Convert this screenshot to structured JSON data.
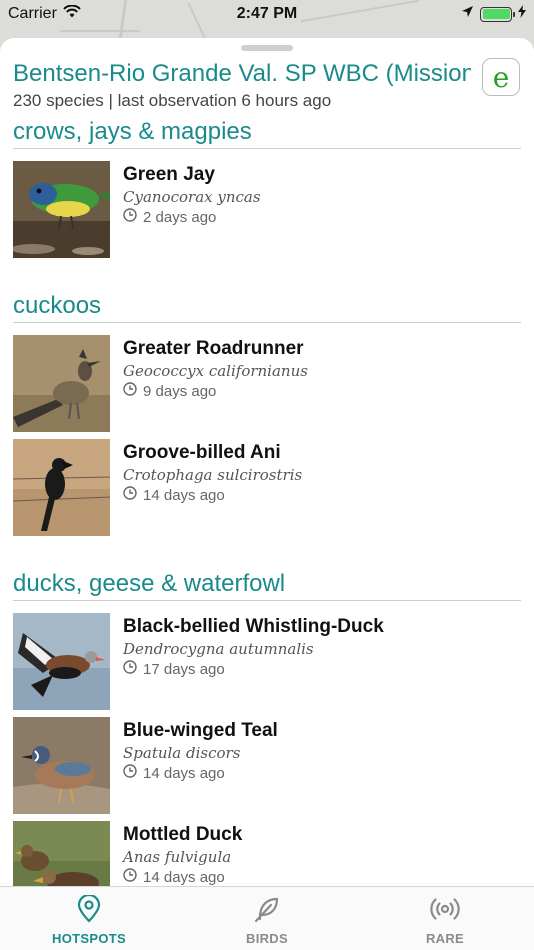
{
  "status_bar": {
    "carrier": "Carrier",
    "time": "2:47 PM"
  },
  "hotspot": {
    "title": "Bentsen-Rio Grande Val. SP WBC (Mission)",
    "subtitle": "230 species | last observation 6 hours ago",
    "ebird_label": "e"
  },
  "groups": [
    {
      "title": "crows, jays & magpies",
      "birds": [
        {
          "name": "Green Jay",
          "scientific": "Cyanocorax yncas",
          "when": "2 days ago"
        }
      ]
    },
    {
      "title": "cuckoos",
      "birds": [
        {
          "name": "Greater Roadrunner",
          "scientific": "Geococcyx californianus",
          "when": "9 days ago"
        },
        {
          "name": "Groove-billed Ani",
          "scientific": "Crotophaga sulcirostris",
          "when": "14 days ago"
        }
      ]
    },
    {
      "title": "ducks, geese & waterfowl",
      "birds": [
        {
          "name": "Black-bellied Whistling-Duck",
          "scientific": "Dendrocygna autumnalis",
          "when": "17 days ago"
        },
        {
          "name": "Blue-winged Teal",
          "scientific": "Spatula discors",
          "when": "14 days ago"
        },
        {
          "name": "Mottled Duck",
          "scientific": "Anas fulvigula",
          "when": "14 days ago"
        }
      ]
    }
  ],
  "tabs": [
    {
      "label": "HOTSPOTS",
      "icon": "map-pin-icon",
      "active": true
    },
    {
      "label": "BIRDS",
      "icon": "feather-icon",
      "active": false
    },
    {
      "label": "RARE",
      "icon": "broadcast-icon",
      "active": false
    }
  ],
  "colors": {
    "accent": "#1a8a8a",
    "inactive_tab": "#8a8a8a",
    "ebird_green": "#2e9c2e"
  }
}
